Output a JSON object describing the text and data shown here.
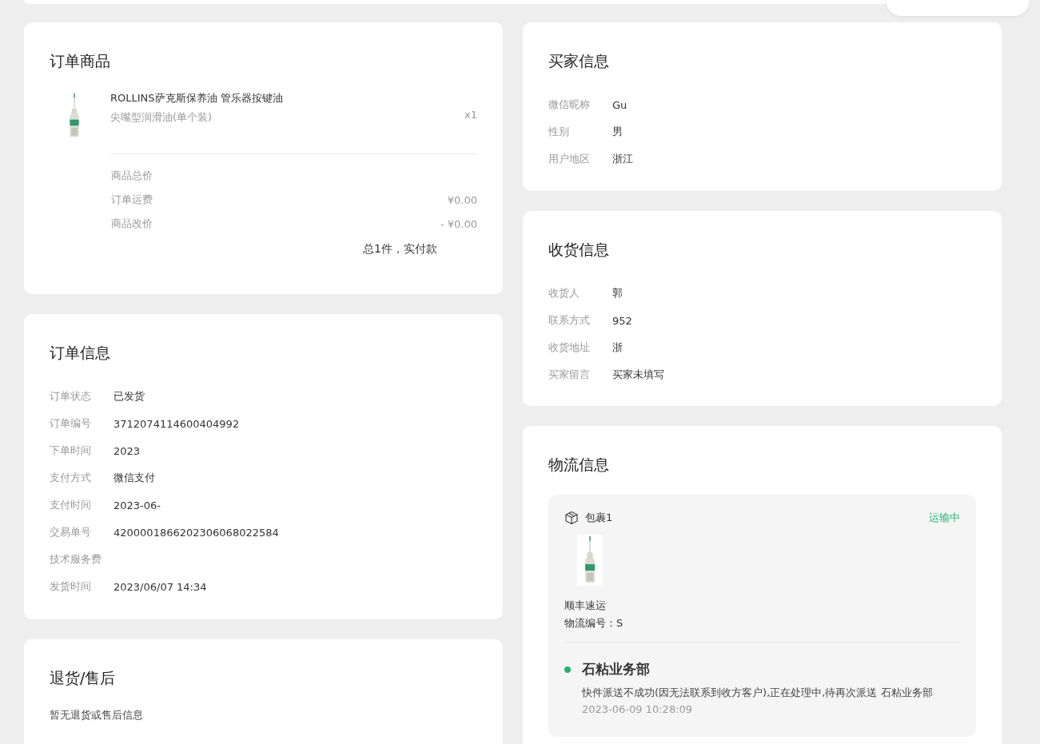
{
  "order_goods": {
    "title": "订单商品",
    "product": {
      "name": "ROLLINS萨克斯保养油 管乐器按键油",
      "variant": "尖嘴型润滑油(单个装)",
      "quantity": "x1"
    },
    "summary": [
      {
        "label": "商品总价"
      },
      {
        "label": "订单运费",
        "value": "¥0.00"
      },
      {
        "label": "商品改价",
        "value": "- ¥0.00"
      }
    ],
    "total_label": "总1件，实付款"
  },
  "order_info": {
    "title": "订单信息",
    "rows": [
      {
        "label": "订单状态",
        "value": "已发货"
      },
      {
        "label": "订单编号",
        "value": "3712074114600404992"
      },
      {
        "label": "下单时间",
        "value": "2023"
      },
      {
        "label": "支付方式",
        "value": "微信支付"
      },
      {
        "label": "支付时间",
        "value": "2023-06-"
      },
      {
        "label": "交易单号",
        "value": "4200001866202306068022584"
      },
      {
        "label": "技术服务费"
      },
      {
        "label": "发货时间",
        "value": "2023/06/07 14:34"
      }
    ]
  },
  "after_sales": {
    "title": "退货/售后",
    "message": "暂无退货或售后信息"
  },
  "buyer_info": {
    "title": "买家信息",
    "rows": [
      {
        "label": "微信昵称",
        "value": "Gu"
      },
      {
        "label": "性别",
        "value": "男"
      },
      {
        "label": "用户地区",
        "value": "浙江"
      }
    ]
  },
  "shipping_info": {
    "title": "收货信息",
    "rows": [
      {
        "label": "收货人",
        "value": "郭"
      },
      {
        "label": "联系方式",
        "value": "952"
      },
      {
        "label": "收货地址",
        "value": "浙"
      },
      {
        "label": "买家留言",
        "value": "买家未填写"
      }
    ]
  },
  "logistics": {
    "title": "物流信息",
    "package": {
      "name": "包裹1",
      "status": "运输中",
      "carrier": "顺丰速运",
      "tracking": "物流编号：S"
    },
    "events": [
      {
        "title": "石粘业务部",
        "description": "快件派送不成功(因无法联系到收方客户),正在处理中,待再次派送 石粘业务部",
        "time": "2023-06-09 10:28:09"
      }
    ]
  }
}
